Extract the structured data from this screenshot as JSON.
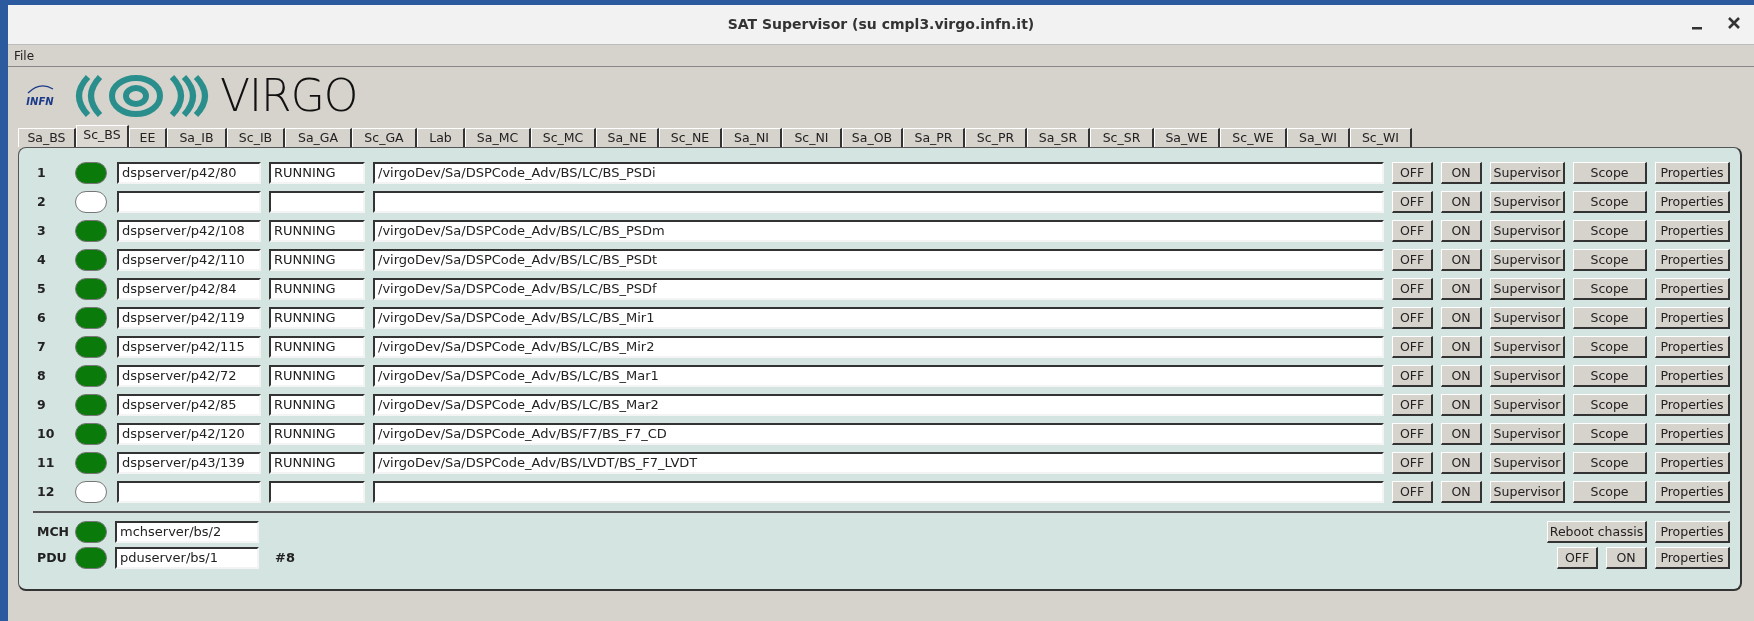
{
  "window": {
    "title": "SAT Supervisor (su cmpl3.virgo.infn.it)"
  },
  "menu": [
    "File"
  ],
  "logo": {
    "org": "INFN",
    "name": "VIRGO"
  },
  "tabs": [
    {
      "label": "Sa_BS",
      "selected": false
    },
    {
      "label": "Sc_BS",
      "selected": true
    },
    {
      "label": "EE",
      "selected": false
    },
    {
      "label": "Sa_IB",
      "selected": false
    },
    {
      "label": "Sc_IB",
      "selected": false
    },
    {
      "label": "Sa_GA",
      "selected": false
    },
    {
      "label": "Sc_GA",
      "selected": false
    },
    {
      "label": "Lab",
      "selected": false
    },
    {
      "label": "Sa_MC",
      "selected": false
    },
    {
      "label": "Sc_MC",
      "selected": false
    },
    {
      "label": "Sa_NE",
      "selected": false
    },
    {
      "label": "Sc_NE",
      "selected": false
    },
    {
      "label": "Sa_NI",
      "selected": false
    },
    {
      "label": "Sc_NI",
      "selected": false
    },
    {
      "label": "Sa_OB",
      "selected": false
    },
    {
      "label": "Sa_PR",
      "selected": false
    },
    {
      "label": "Sc_PR",
      "selected": false
    },
    {
      "label": "Sa_SR",
      "selected": false
    },
    {
      "label": "Sc_SR",
      "selected": false
    },
    {
      "label": "Sa_WE",
      "selected": false
    },
    {
      "label": "Sc_WE",
      "selected": false
    },
    {
      "label": "Sa_WI",
      "selected": false
    },
    {
      "label": "Sc_WI",
      "selected": false
    }
  ],
  "rows": [
    {
      "number": "1",
      "on": true,
      "host": "dspserver/p42/80",
      "status": "RUNNING",
      "path": "/virgoDev/Sa/DSPCode_Adv/BS/LC/BS_PSDi",
      "buttons": [
        "OFF",
        "ON",
        "Supervisor",
        "Scope",
        "Properties"
      ]
    },
    {
      "number": "2",
      "on": false,
      "buttons": [
        "OFF",
        "ON",
        "Supervisor",
        "Scope",
        "Properties"
      ]
    },
    {
      "number": "3",
      "on": true,
      "host": "dspserver/p42/108",
      "status": "RUNNING",
      "path": "/virgoDev/Sa/DSPCode_Adv/BS/LC/BS_PSDm",
      "buttons": [
        "OFF",
        "ON",
        "Supervisor",
        "Scope",
        "Properties"
      ]
    },
    {
      "number": "4",
      "on": true,
      "host": "dspserver/p42/110",
      "status": "RUNNING",
      "path": "/virgoDev/Sa/DSPCode_Adv/BS/LC/BS_PSDt",
      "buttons": [
        "OFF",
        "ON",
        "Supervisor",
        "Scope",
        "Properties"
      ]
    },
    {
      "number": "5",
      "on": true,
      "host": "dspserver/p42/84",
      "status": "RUNNING",
      "path": "/virgoDev/Sa/DSPCode_Adv/BS/LC/BS_PSDf",
      "buttons": [
        "OFF",
        "ON",
        "Supervisor",
        "Scope",
        "Properties"
      ]
    },
    {
      "number": "6",
      "on": true,
      "host": "dspserver/p42/119",
      "status": "RUNNING",
      "path": "/virgoDev/Sa/DSPCode_Adv/BS/LC/BS_Mir1",
      "buttons": [
        "OFF",
        "ON",
        "Supervisor",
        "Scope",
        "Properties"
      ]
    },
    {
      "number": "7",
      "on": true,
      "host": "dspserver/p42/115",
      "status": "RUNNING",
      "path": "/virgoDev/Sa/DSPCode_Adv/BS/LC/BS_Mir2",
      "buttons": [
        "OFF",
        "ON",
        "Supervisor",
        "Scope",
        "Properties"
      ]
    },
    {
      "number": "8",
      "on": true,
      "host": "dspserver/p42/72",
      "status": "RUNNING",
      "path": "/virgoDev/Sa/DSPCode_Adv/BS/LC/BS_Mar1",
      "buttons": [
        "OFF",
        "ON",
        "Supervisor",
        "Scope",
        "Properties"
      ]
    },
    {
      "number": "9",
      "on": true,
      "host": "dspserver/p42/85",
      "status": "RUNNING",
      "path": "/virgoDev/Sa/DSPCode_Adv/BS/LC/BS_Mar2",
      "buttons": [
        "OFF",
        "ON",
        "Supervisor",
        "Scope",
        "Properties"
      ]
    },
    {
      "number": "10",
      "on": true,
      "host": "dspserver/p42/120",
      "status": "RUNNING",
      "path": "/virgoDev/Sa/DSPCode_Adv/BS/F7/BS_F7_CD",
      "buttons": [
        "OFF",
        "ON",
        "Supervisor",
        "Scope",
        "Properties"
      ]
    },
    {
      "number": "11",
      "on": true,
      "host": "dspserver/p43/139",
      "status": "RUNNING",
      "path": "/virgoDev/Sa/DSPCode_Adv/BS/LVDT/BS_F7_LVDT",
      "buttons": [
        "OFF",
        "ON",
        "Supervisor",
        "Scope",
        "Properties"
      ]
    },
    {
      "number": "12",
      "on": false,
      "buttons": [
        "OFF",
        "ON",
        "Supervisor",
        "Scope",
        "Properties"
      ]
    }
  ],
  "chassis": [
    {
      "label": "MCH",
      "on": true,
      "host": "mchserver/bs/2",
      "buttons": [
        "Reboot chassis",
        "Properties"
      ]
    },
    {
      "label": "PDU",
      "on": true,
      "host": "pduserver/bs/1",
      "note": "#8",
      "buttons": [
        "OFF",
        "ON",
        "Properties"
      ]
    }
  ]
}
